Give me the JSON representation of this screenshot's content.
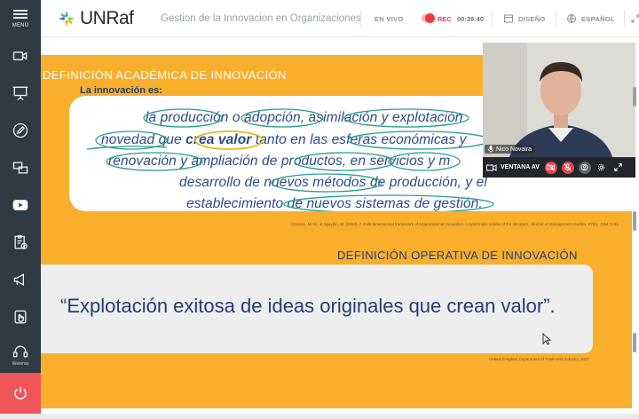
{
  "sidebar": {
    "menu_label": "MENÚ",
    "items": [
      {
        "icon": "video-camera-icon"
      },
      {
        "icon": "presentation-icon"
      },
      {
        "icon": "pencil-icon"
      },
      {
        "icon": "screen-share-icon"
      },
      {
        "icon": "youtube-icon"
      },
      {
        "icon": "clipboard-check-icon"
      },
      {
        "icon": "megaphone-icon"
      },
      {
        "icon": "hand-raise-icon"
      },
      {
        "icon": "headset-icon",
        "label": "Webinar"
      }
    ],
    "power_icon": "power-icon"
  },
  "header": {
    "logo_text": "UNRaf",
    "title": "Gestion de la Innovacion en Organizaciones",
    "live_label": "EN VIVO",
    "rec_label": "REC",
    "rec_time": "00:39:40",
    "design_label": "DISEÑO",
    "language_label": "ESPAÑOL"
  },
  "slide": {
    "title1": "DEFINICIÓN ACADÉMICA DE INNOVACIÓN",
    "subtitle": "La innovación es:",
    "quote_lines": [
      "la producción o adopción, asimilación y explotación",
      "novedad que",
      "crea valor",
      "tanto en las esferas económicas y",
      "renovación y ampliación de productos, en servicios y m",
      "desarrollo de nuevos métodos de producción, y el",
      "establecimiento de nuevos sistemas de gestión."
    ],
    "citation1": "Crossan, M. M., & Apaydin, M. (2010). A multi-dimensional framework of organizational innovation: A systematic review of the literature. Journal of management studies, 47(6), 1154-1191.",
    "title2": "DEFINICIÓN OPERATIVA DE INNOVACIÓN",
    "quote2": "“Explotación exitosa de ideas originales que crean valor”.",
    "citation2": "United Kingdom Department of Trade and Industry, 2007"
  },
  "video": {
    "participant_name": "Nico Novaira",
    "window_label": "VENTANA AV"
  },
  "colors": {
    "sidebar": "#2f3a45",
    "slide_orange": "#f9ae2c",
    "slide_blue": "#1f3f73",
    "rec_red": "#ee3b43",
    "power_red": "#f0555a",
    "annotation_teal": "#2a9d8f"
  }
}
